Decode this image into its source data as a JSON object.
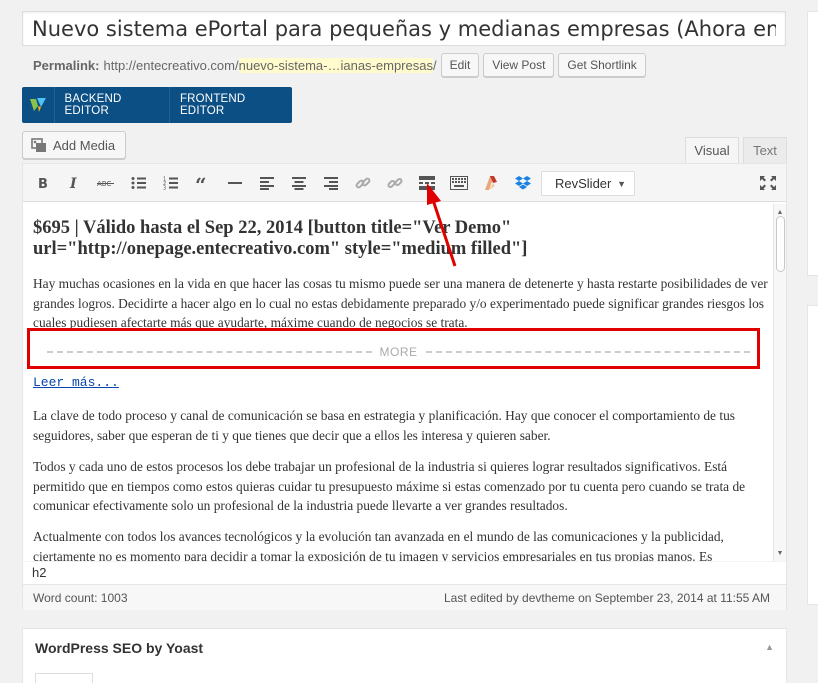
{
  "title": {
    "value": "Nuevo sistema ePortal para pequeñas y medianas empresas (Ahora en C"
  },
  "permalink": {
    "label": "Permalink:",
    "base": "http://entecreativo.com/",
    "slug": "nuevo-sistema-…ianas-empresas",
    "trail": "/",
    "edit": "Edit",
    "view": "View Post",
    "shortlink": "Get Shortlink"
  },
  "composer": {
    "backend": "BACKEND EDITOR",
    "frontend": "FRONTEND EDITOR"
  },
  "add_media": "Add Media",
  "tabs": {
    "visual": "Visual",
    "text": "Text"
  },
  "toolbar": {
    "icons": [
      "bold-icon",
      "italic-icon",
      "strikethrough-icon",
      "bullet-list-icon",
      "numbered-list-icon",
      "blockquote-icon",
      "horizontal-rule-icon",
      "align-left-icon",
      "align-center-icon",
      "align-right-icon",
      "insert-link-icon",
      "remove-link-icon",
      "insert-more-icon",
      "toolbar-toggle-icon",
      "revslider-icon",
      "dropbox-icon",
      "fullscreen-icon"
    ],
    "revslider": "RevSlider"
  },
  "content": {
    "heading": "$695 | Válido hasta el Sep 22, 2014 [button title=\"Ver Demo\" url=\"http://onepage.entecreativo.com\" style=\"medium filled\"]",
    "p1": "Hay muchas ocasiones en la vida en que hacer las cosas tu mismo puede ser una manera de detenerte y hasta restarte posibilidades de ver grandes logros. Decidirte a hacer algo en lo cual no estas debidamente preparado y/o experimentado puede significar grandes riesgos los cuales pudiesen afectarte más que ayudarte, máxime cuando de negocios se trata.",
    "more": "MORE",
    "read_more": "Leer más...",
    "p2": "La clave de todo proceso y canal de comunicación se basa en estrategia y planificación. Hay que conocer el comportamiento de tus seguidores, saber que esperan de ti y que tienes que decir que a ellos les interesa y quieren saber.",
    "p3": "Todos y cada uno de estos procesos los debe trabajar un profesional de la industria si quieres lograr resultados significativos. Está permitido que en tiempos como estos quieras cuidar tu presupuesto máxime si estas comenzado por tu cuenta pero cuando se trata de comunicar efectivamente solo un profesional de la industria puede llevarte a ver grandes resultados.",
    "p4": "Actualmente con todos los avances tecnológicos y la evolución tan avanzada en el mundo de las comunicaciones y la publicidad, ciertamente no es momento para decidir a tomar la exposición de tu imagen y servicios empresariales en tus propias manos. Es"
  },
  "path": "h2",
  "status": {
    "word_count": "Word count: 1003",
    "last_edited": "Last edited by devtheme on September 23, 2014 at 11:55 AM"
  },
  "seo": {
    "title": "WordPress SEO by Yoast"
  },
  "colors": {
    "composer_bg": "#0c4f84",
    "highlight": "#e00000",
    "slug_bg": "#fffbcc"
  }
}
